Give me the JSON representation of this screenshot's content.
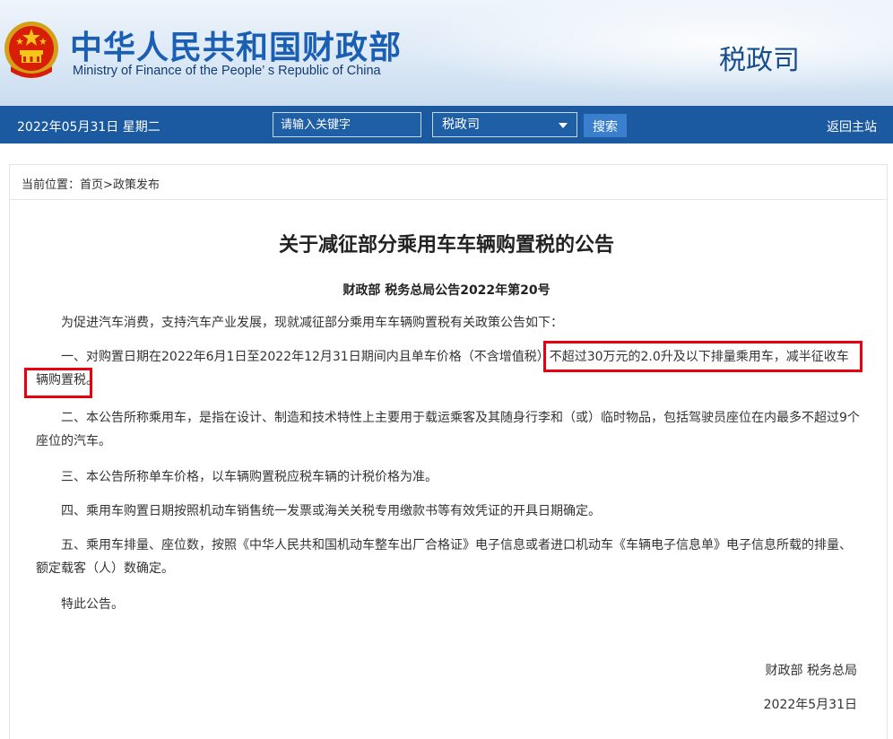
{
  "header": {
    "site_title_cn": "中华人民共和国财政部",
    "site_title_en": "Ministry of Finance of the People’ s Republic of China",
    "department": "税政司",
    "emblem_icon": "national-emblem-icon"
  },
  "navbar": {
    "date": "2022年05月31日  星期二",
    "search_placeholder": "请输入关键字",
    "scope_selected": "税政司",
    "search_button": "搜索",
    "home_link": "返回主站"
  },
  "breadcrumb": {
    "prefix": "当前位置：",
    "home": "首页",
    "separator": ">",
    "section": "政策发布"
  },
  "article": {
    "title": "关于减征部分乘用车车辆购置税的公告",
    "doc_number": "财政部 税务总局公告2022年第20号",
    "paragraphs": [
      "为促进汽车消费，支持汽车产业发展，现就减征部分乘用车车辆购置税有关政策公告如下：",
      "一、对购置日期在2022年6月1日至2022年12月31日期间内且单车价格（不含增值税）不超过30万元的2.0升及以下排量乘用车，减半征收车辆购置税。",
      "二、本公告所称乘用车，是指在设计、制造和技术特性上主要用于载运乘客及其随身行李和（或）临时物品，包括驾驶员座位在内最多不超过9个座位的汽车。",
      "三、本公告所称单车价格，以车辆购置税应税车辆的计税价格为准。",
      "四、乘用车购置日期按照机动车销售统一发票或海关关税专用缴款书等有效凭证的开具日期确定。",
      "五、乘用车排量、座位数，按照《中华人民共和国机动车整车出厂合格证》电子信息或者进口机动车《车辆电子信息单》电子信息所载的排量、额定载客（人）数确定。",
      "特此公告。"
    ],
    "signature_org": "财政部 税务总局",
    "signature_date": "2022年5月31日"
  },
  "colors": {
    "brand_blue": "#1a5fb4",
    "navbar_bg": "#1b5aa0",
    "highlight_red": "#e60012"
  }
}
